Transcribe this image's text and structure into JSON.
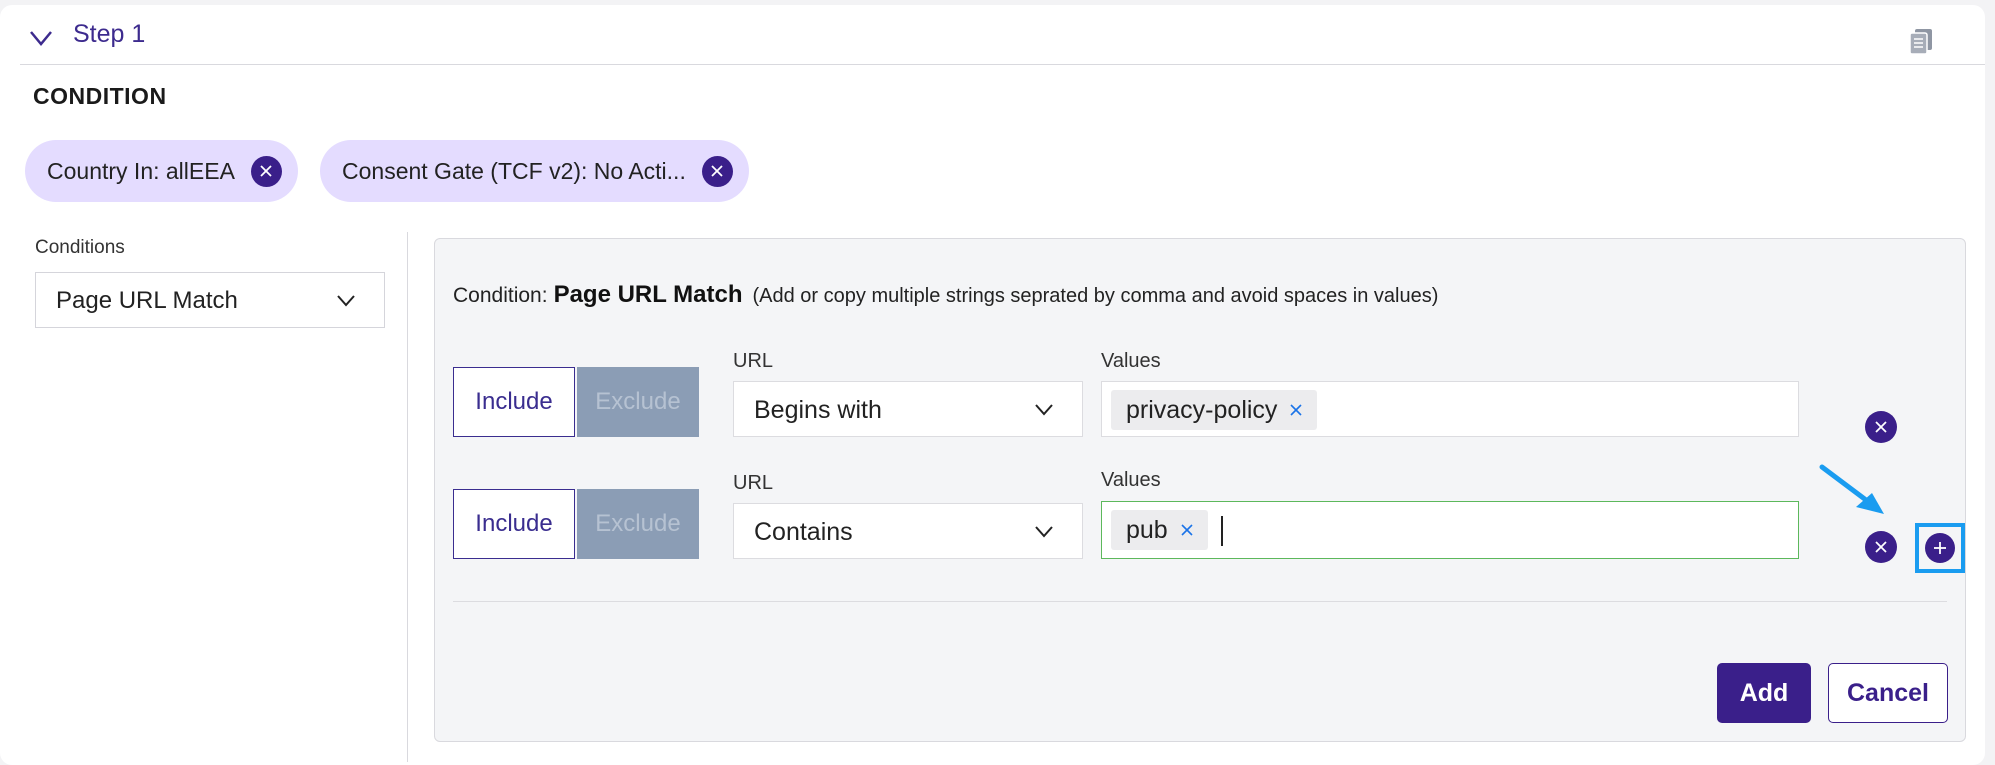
{
  "step": {
    "title": "Step 1",
    "toggle_icon": "chevron-down-icon",
    "copy_icon": "copy-icon"
  },
  "section_title": "CONDITION",
  "chips": [
    {
      "label": "Country In: allEEA"
    },
    {
      "label": "Consent Gate (TCF v2): No Acti..."
    }
  ],
  "conditions_panel": {
    "label": "Conditions",
    "selected": "Page URL Match"
  },
  "editor": {
    "prefix": "Condition:",
    "name": "Page URL Match",
    "note": "(Add or copy multiple strings seprated by comma and avoid spaces in values)",
    "rows": [
      {
        "include_label": "Include",
        "exclude_label": "Exclude",
        "url_label": "URL",
        "url_operator": "Begins with",
        "values_label": "Values",
        "values": [
          "privacy-policy"
        ]
      },
      {
        "include_label": "Include",
        "exclude_label": "Exclude",
        "url_label": "URL",
        "url_operator": "Contains",
        "values_label": "Values",
        "values": [
          "pub"
        ]
      }
    ]
  },
  "actions": {
    "add_label": "Add",
    "cancel_label": "Cancel"
  },
  "colors": {
    "primary": "#3a1f8a",
    "chip_bg": "#e4dcff",
    "highlight": "#1a9cf0",
    "focus_border": "#5cb85c"
  }
}
